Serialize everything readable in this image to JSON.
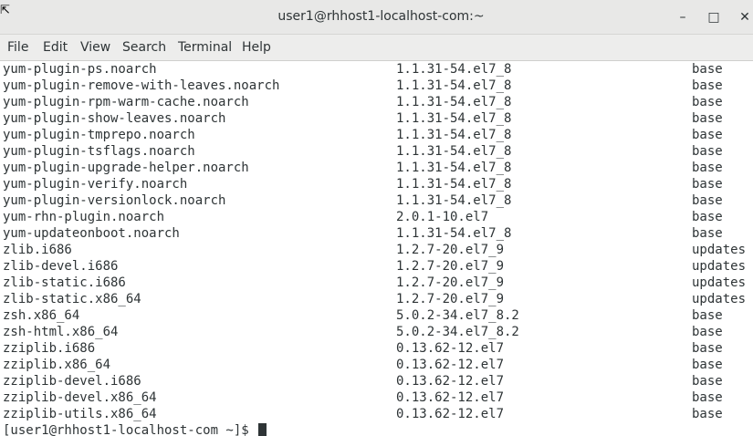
{
  "window": {
    "title": "user1@rhhost1-localhost-com:~"
  },
  "controls": {
    "minimize": "–",
    "maximize": "□",
    "close": "✕"
  },
  "menu": [
    "File",
    "Edit",
    "View",
    "Search",
    "Terminal",
    "Help"
  ],
  "rows": [
    [
      "yum-plugin-ps.noarch",
      "1.1.31-54.el7_8",
      "base"
    ],
    [
      "yum-plugin-remove-with-leaves.noarch",
      "1.1.31-54.el7_8",
      "base"
    ],
    [
      "yum-plugin-rpm-warm-cache.noarch",
      "1.1.31-54.el7_8",
      "base"
    ],
    [
      "yum-plugin-show-leaves.noarch",
      "1.1.31-54.el7_8",
      "base"
    ],
    [
      "yum-plugin-tmprepo.noarch",
      "1.1.31-54.el7_8",
      "base"
    ],
    [
      "yum-plugin-tsflags.noarch",
      "1.1.31-54.el7_8",
      "base"
    ],
    [
      "yum-plugin-upgrade-helper.noarch",
      "1.1.31-54.el7_8",
      "base"
    ],
    [
      "yum-plugin-verify.noarch",
      "1.1.31-54.el7_8",
      "base"
    ],
    [
      "yum-plugin-versionlock.noarch",
      "1.1.31-54.el7_8",
      "base"
    ],
    [
      "yum-rhn-plugin.noarch",
      "2.0.1-10.el7",
      "base"
    ],
    [
      "yum-updateonboot.noarch",
      "1.1.31-54.el7_8",
      "base"
    ],
    [
      "zlib.i686",
      "1.2.7-20.el7_9",
      "updates"
    ],
    [
      "zlib-devel.i686",
      "1.2.7-20.el7_9",
      "updates"
    ],
    [
      "zlib-static.i686",
      "1.2.7-20.el7_9",
      "updates"
    ],
    [
      "zlib-static.x86_64",
      "1.2.7-20.el7_9",
      "updates"
    ],
    [
      "zsh.x86_64",
      "5.0.2-34.el7_8.2",
      "base"
    ],
    [
      "zsh-html.x86_64",
      "5.0.2-34.el7_8.2",
      "base"
    ],
    [
      "zziplib.i686",
      "0.13.62-12.el7",
      "base"
    ],
    [
      "zziplib.x86_64",
      "0.13.62-12.el7",
      "base"
    ],
    [
      "zziplib-devel.i686",
      "0.13.62-12.el7",
      "base"
    ],
    [
      "zziplib-devel.x86_64",
      "0.13.62-12.el7",
      "base"
    ],
    [
      "zziplib-utils.x86_64",
      "0.13.62-12.el7",
      "base"
    ]
  ],
  "prompt": "[user1@rhhost1-localhost-com ~]$ "
}
